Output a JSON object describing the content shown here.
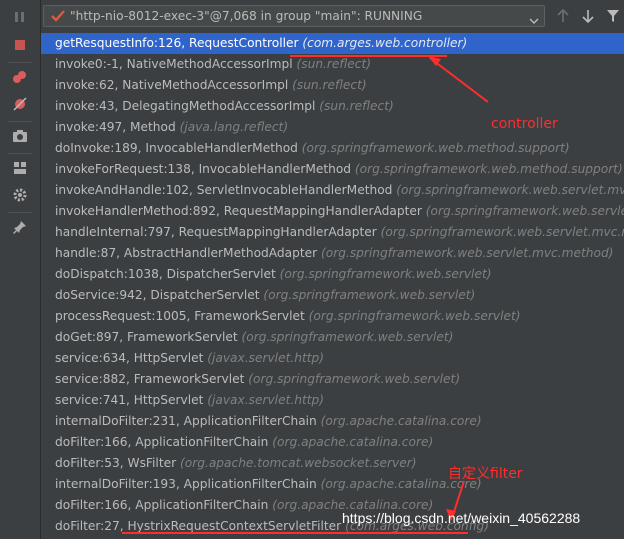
{
  "thread_selector": {
    "label": "\"http-nio-8012-exec-3\"@7,068 in group \"main\": RUNNING"
  },
  "frames": [
    {
      "method": "getResquestInfo:126, RequestController",
      "pkg": "(com.arges.web.controller)",
      "selected": true
    },
    {
      "method": "invoke0:-1, NativeMethodAccessorImpl",
      "pkg": "(sun.reflect)"
    },
    {
      "method": "invoke:62, NativeMethodAccessorImpl",
      "pkg": "(sun.reflect)"
    },
    {
      "method": "invoke:43, DelegatingMethodAccessorImpl",
      "pkg": "(sun.reflect)"
    },
    {
      "method": "invoke:497, Method",
      "pkg": "(java.lang.reflect)"
    },
    {
      "method": "doInvoke:189, InvocableHandlerMethod",
      "pkg": "(org.springframework.web.method.support)"
    },
    {
      "method": "invokeForRequest:138, InvocableHandlerMethod",
      "pkg": "(org.springframework.web.method.support)"
    },
    {
      "method": "invokeAndHandle:102, ServletInvocableHandlerMethod",
      "pkg": "(org.springframework.web.servlet.mvc.meth"
    },
    {
      "method": "invokeHandlerMethod:892, RequestMappingHandlerAdapter",
      "pkg": "(org.springframework.web.servlet.m"
    },
    {
      "method": "handleInternal:797, RequestMappingHandlerAdapter",
      "pkg": "(org.springframework.web.servlet.mvc.metho"
    },
    {
      "method": "handle:87, AbstractHandlerMethodAdapter",
      "pkg": "(org.springframework.web.servlet.mvc.method)"
    },
    {
      "method": "doDispatch:1038, DispatcherServlet",
      "pkg": "(org.springframework.web.servlet)"
    },
    {
      "method": "doService:942, DispatcherServlet",
      "pkg": "(org.springframework.web.servlet)"
    },
    {
      "method": "processRequest:1005, FrameworkServlet",
      "pkg": "(org.springframework.web.servlet)"
    },
    {
      "method": "doGet:897, FrameworkServlet",
      "pkg": "(org.springframework.web.servlet)"
    },
    {
      "method": "service:634, HttpServlet",
      "pkg": "(javax.servlet.http)"
    },
    {
      "method": "service:882, FrameworkServlet",
      "pkg": "(org.springframework.web.servlet)"
    },
    {
      "method": "service:741, HttpServlet",
      "pkg": "(javax.servlet.http)"
    },
    {
      "method": "internalDoFilter:231, ApplicationFilterChain",
      "pkg": "(org.apache.catalina.core)"
    },
    {
      "method": "doFilter:166, ApplicationFilterChain",
      "pkg": "(org.apache.catalina.core)"
    },
    {
      "method": "doFilter:53, WsFilter",
      "pkg": "(org.apache.tomcat.websocket.server)"
    },
    {
      "method": "internalDoFilter:193, ApplicationFilterChain",
      "pkg": "(org.apache.catalina.core)"
    },
    {
      "method": "doFilter:166, ApplicationFilterChain",
      "pkg": "(org.apache.catalina.core)"
    },
    {
      "method": "doFilter:27, HystrixRequestContextServletFilter",
      "pkg": "(com.arges.web.config)"
    }
  ],
  "annotations": {
    "controller_label": "controller",
    "filter_label": "自定义filter"
  },
  "watermark": "https://blog.csdn.net/weixin_40562288",
  "colors": {
    "selection": "#2f65ca",
    "annotation": "#ff2d2d"
  },
  "icons": {
    "left_toolbar": [
      "pause-icon",
      "stop-icon",
      "view-breakpoints-icon",
      "mute-breakpoints-icon",
      "camera-icon",
      "layout-icon",
      "settings-icon",
      "pin-icon"
    ],
    "top_bar": [
      "thread-check-icon",
      "dropdown-caret-icon",
      "up-arrow-icon",
      "down-arrow-icon",
      "filter-icon"
    ]
  }
}
